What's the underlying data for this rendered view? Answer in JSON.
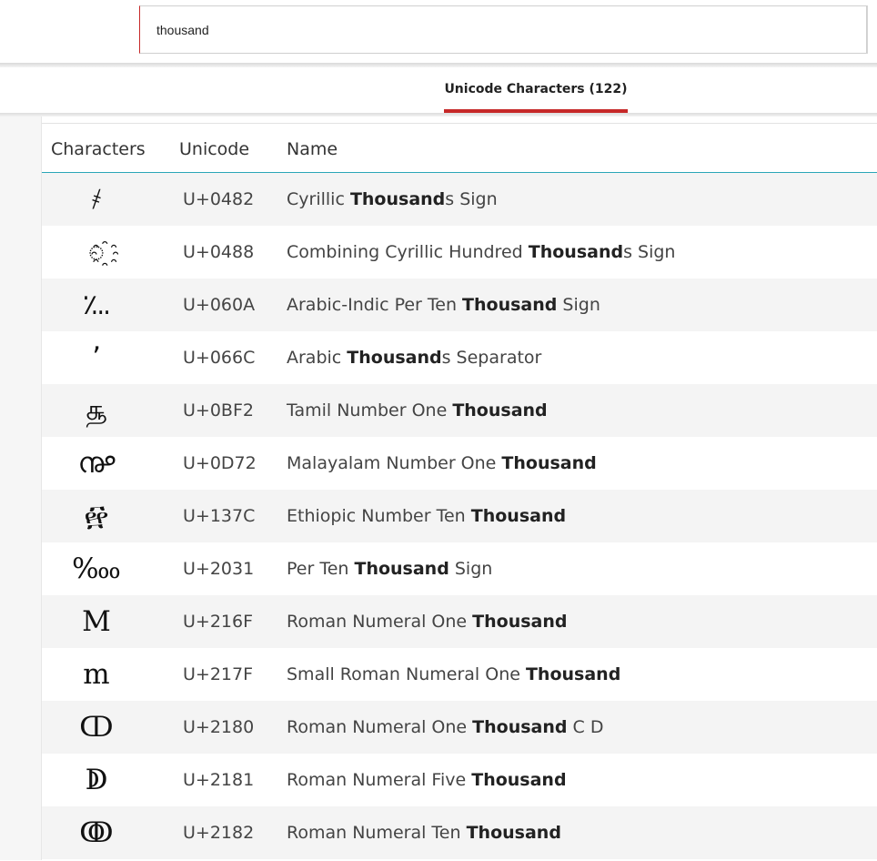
{
  "search": {
    "value": "thousand"
  },
  "tabs": [
    {
      "label": "Unicode Characters (122)"
    }
  ],
  "table": {
    "headers": [
      "Characters",
      "Unicode",
      "Name"
    ],
    "rows": [
      {
        "char": "҂",
        "code": "U+0482",
        "pre": "Cyrillic ",
        "match": "Thousand",
        "post": "s Sign"
      },
      {
        "char": "◌҈",
        "code": "U+0488",
        "pre": "Combining Cyrillic Hundred ",
        "match": "Thousand",
        "post": "s Sign"
      },
      {
        "char": "؊",
        "code": "U+060A",
        "pre": "Arabic-Indic Per Ten ",
        "match": "Thousand",
        "post": " Sign"
      },
      {
        "char": "٬",
        "code": "U+066C",
        "pre": "Arabic ",
        "match": "Thousand",
        "post": "s Separator"
      },
      {
        "char": "௲",
        "code": "U+0BF2",
        "pre": "Tamil Number One ",
        "match": "Thousand",
        "post": ""
      },
      {
        "char": "൲",
        "code": "U+0D72",
        "pre": "Malayalam Number One ",
        "match": "Thousand",
        "post": ""
      },
      {
        "char": "፼",
        "code": "U+137C",
        "pre": "Ethiopic Number Ten ",
        "match": "Thousand",
        "post": ""
      },
      {
        "char": "‱",
        "code": "U+2031",
        "pre": "Per Ten ",
        "match": "Thousand",
        "post": " Sign"
      },
      {
        "char": "Ⅿ",
        "code": "U+216F",
        "pre": "Roman Numeral One ",
        "match": "Thousand",
        "post": ""
      },
      {
        "char": "ⅿ",
        "code": "U+217F",
        "pre": "Small Roman Numeral One ",
        "match": "Thousand",
        "post": ""
      },
      {
        "char": "ↀ",
        "code": "U+2180",
        "pre": "Roman Numeral One ",
        "match": "Thousand",
        "post": " C D"
      },
      {
        "char": "ↁ",
        "code": "U+2181",
        "pre": "Roman Numeral Five ",
        "match": "Thousand",
        "post": ""
      },
      {
        "char": "ↂ",
        "code": "U+2182",
        "pre": "Roman Numeral Ten ",
        "match": "Thousand",
        "post": ""
      }
    ]
  }
}
